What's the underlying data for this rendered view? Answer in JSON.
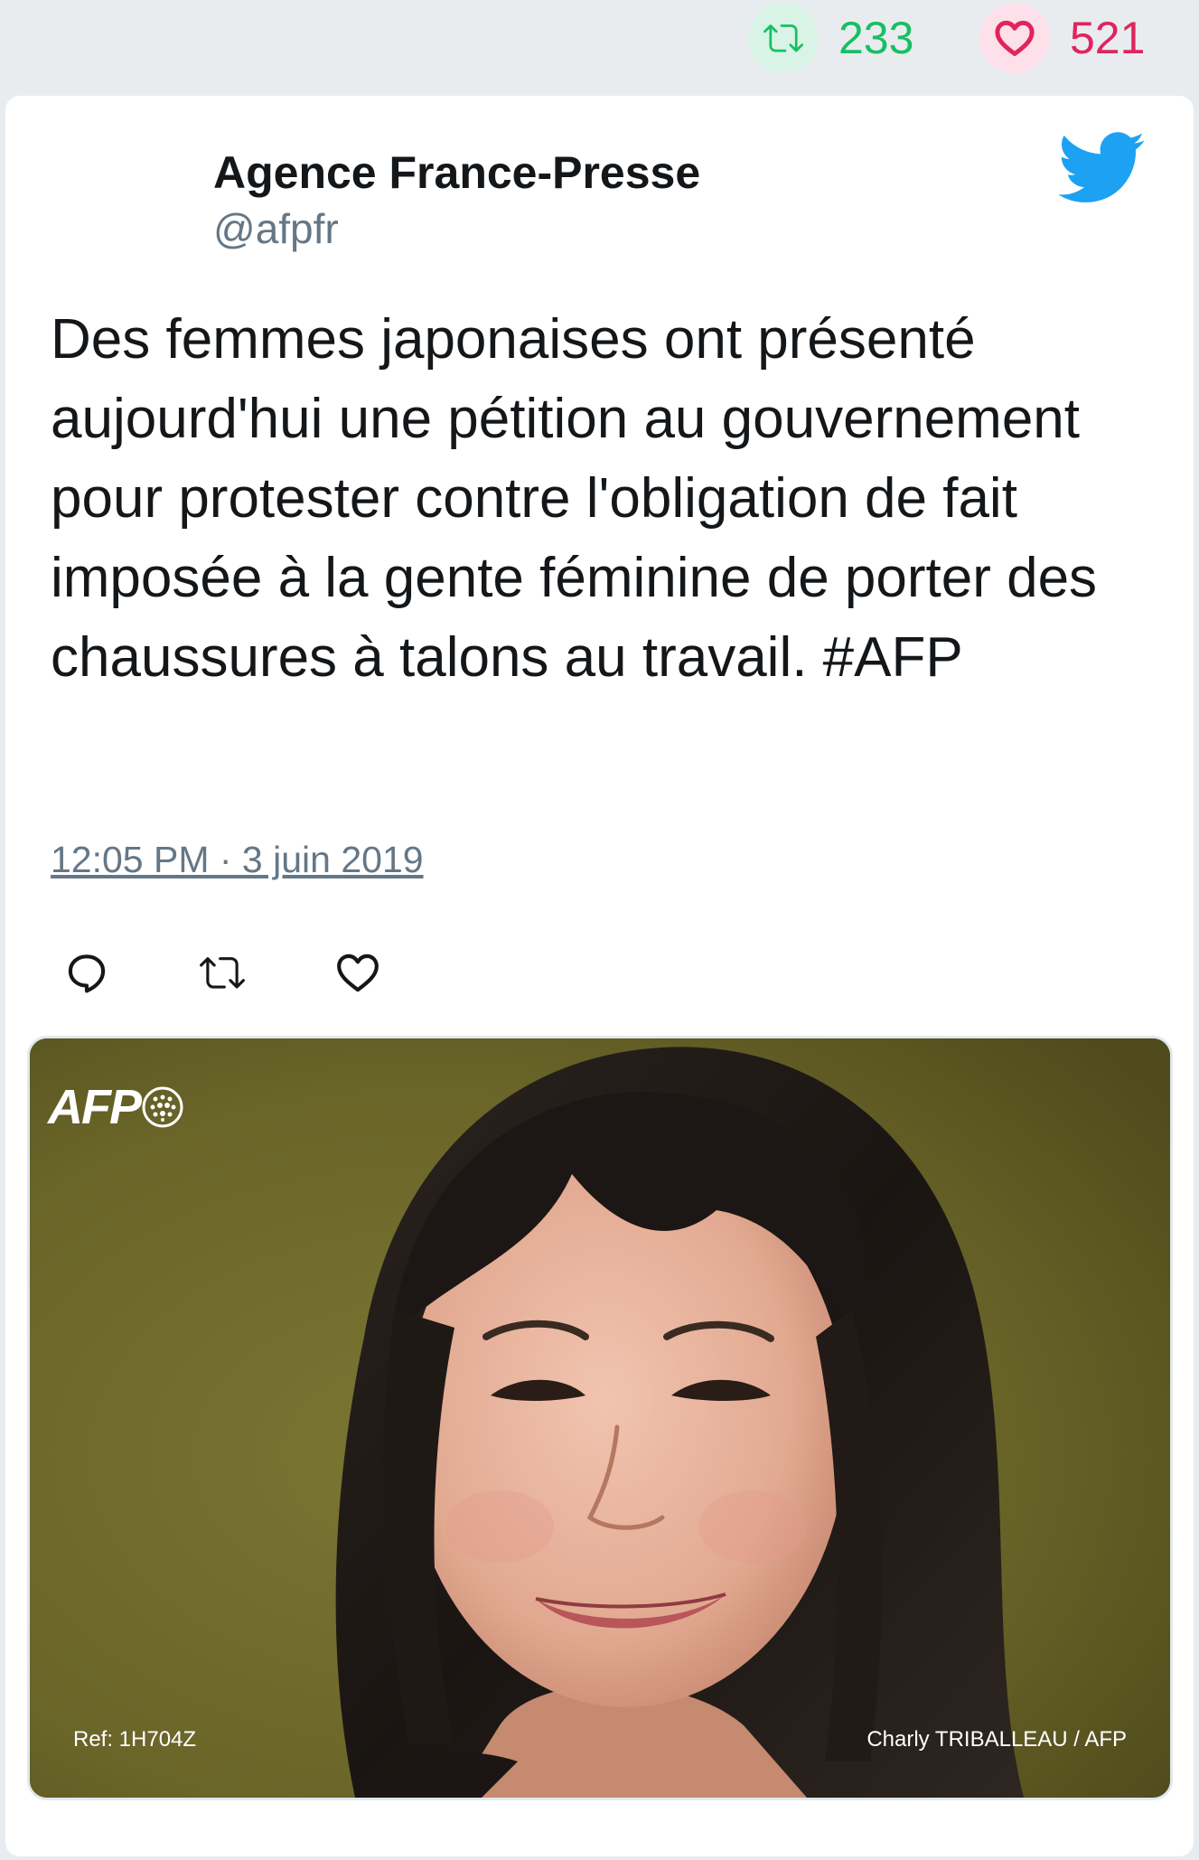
{
  "stats": {
    "retweets": "233",
    "likes": "521"
  },
  "tweet": {
    "author_name": "Agence France-Presse",
    "author_handle": "@afpfr",
    "text": "Des femmes japonaises ont présenté aujourd'hui une pétition au gouvernement pour protester contre l'obligation de fait imposée à la gente féminine de porter des chaussures à talons au travail. #AFP",
    "timestamp": "12:05 PM · 3 juin 2019"
  },
  "photo": {
    "logo_text": "AFP",
    "ref": "Ref: 1H704Z",
    "credit": "Charly TRIBALLEAU / AFP"
  },
  "icons": {
    "retweet": "retweet-icon",
    "like": "heart-icon",
    "reply": "reply-icon",
    "brand": "twitter-bird-icon"
  },
  "colors": {
    "retweet_green": "#17bf63",
    "like_red": "#e0245e",
    "twitter_blue": "#1da1f2",
    "secondary_text": "#657786"
  }
}
